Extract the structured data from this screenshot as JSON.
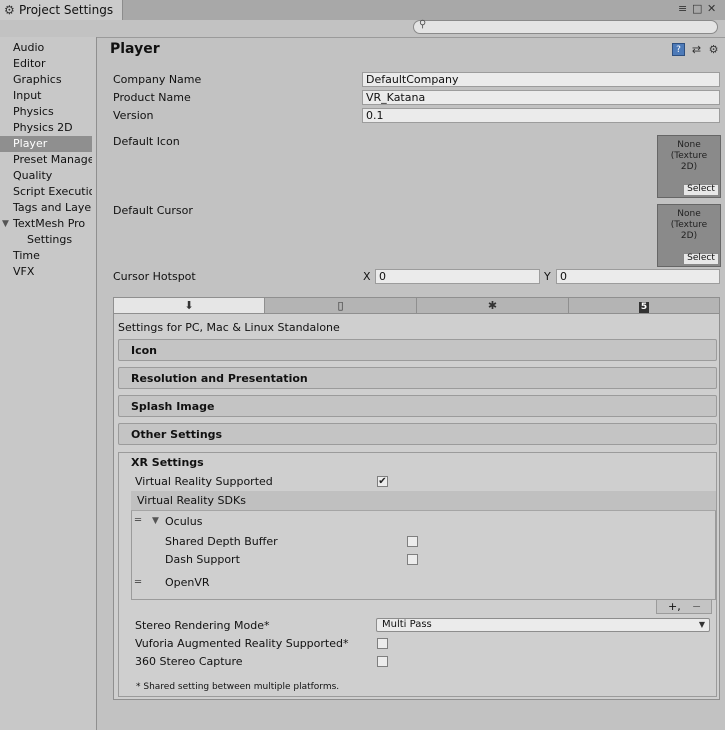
{
  "window": {
    "title": "Project Settings",
    "menu_icon": "≡",
    "maximize_icon": "□",
    "close_icon": "✕"
  },
  "search": {
    "placeholder": ""
  },
  "sidebar": {
    "items": [
      {
        "label": "Audio"
      },
      {
        "label": "Editor"
      },
      {
        "label": "Graphics"
      },
      {
        "label": "Input"
      },
      {
        "label": "Physics"
      },
      {
        "label": "Physics 2D"
      },
      {
        "label": "Player",
        "selected": true
      },
      {
        "label": "Preset Manager"
      },
      {
        "label": "Quality"
      },
      {
        "label": "Script Execution Order"
      },
      {
        "label": "Tags and Layers"
      },
      {
        "label": "TextMesh Pro",
        "expanded": true
      },
      {
        "label": "Settings",
        "indent": true
      },
      {
        "label": "Time"
      },
      {
        "label": "VFX"
      }
    ]
  },
  "header": {
    "title": "Player",
    "help_icon": "?",
    "preset_icon": "⇄",
    "gear_icon": "⚙"
  },
  "fields": {
    "company_label": "Company Name",
    "company_value": "DefaultCompany",
    "product_label": "Product Name",
    "product_value": "VR_Katana",
    "version_label": "Version",
    "version_value": "0.1",
    "icon_label": "Default Icon",
    "cursor_label": "Default Cursor",
    "hotspot_label": "Cursor Hotspot",
    "hotspot_x_label": "X",
    "hotspot_x_value": "0",
    "hotspot_y_label": "Y",
    "hotspot_y_value": "0"
  },
  "texture_box": {
    "line1": "None",
    "line2": "(Texture",
    "line3": "2D)",
    "select_label": "Select"
  },
  "platform_tabs": [
    "download-icon",
    "mobile-icon",
    "android-icon",
    "html5-icon"
  ],
  "platform_glyphs": {
    "download": "⬇",
    "mobile": "▯",
    "android": "✱",
    "html5": "5"
  },
  "settings_for": "Settings for PC, Mac & Linux Standalone",
  "sections": {
    "icon": "Icon",
    "resolution": "Resolution and Presentation",
    "splash": "Splash Image",
    "other": "Other Settings"
  },
  "xr": {
    "title": "XR Settings",
    "vr_supported_label": "Virtual Reality Supported",
    "vr_supported_checked": true,
    "sdks_label": "Virtual Reality SDKs",
    "oculus_label": "Oculus",
    "shared_depth_label": "Shared Depth Buffer",
    "shared_depth_checked": false,
    "dash_label": "Dash Support",
    "dash_checked": false,
    "openvr_label": "OpenVR",
    "add_label": "+,",
    "remove_label": "−",
    "stereo_label": "Stereo Rendering Mode*",
    "stereo_value": "Multi Pass",
    "vuforia_label": "Vuforia Augmented Reality Supported*",
    "vuforia_checked": false,
    "stereo360_label": "360 Stereo Capture",
    "stereo360_checked": false,
    "footnote": "* Shared setting between multiple platforms.",
    "check_mark": "✔"
  }
}
